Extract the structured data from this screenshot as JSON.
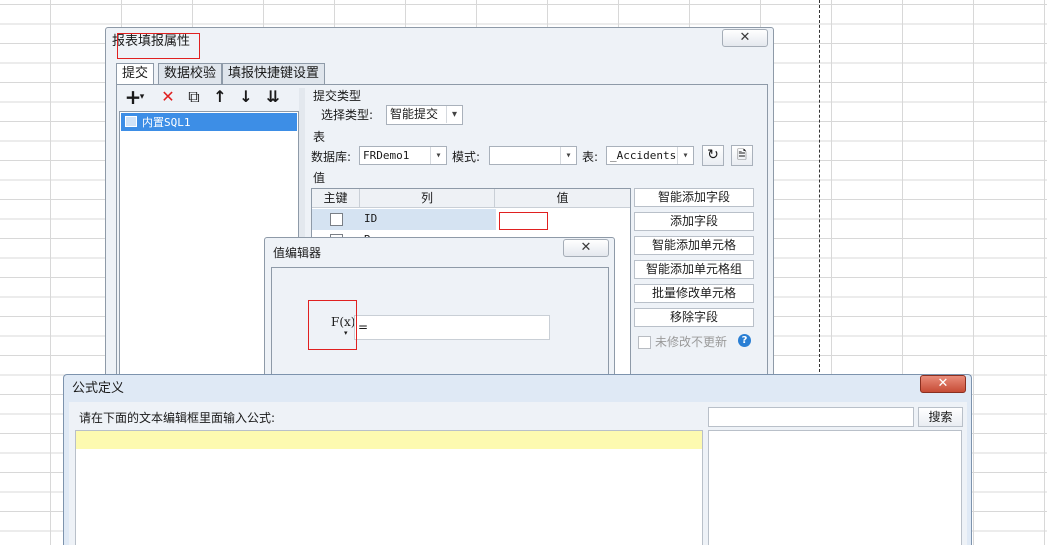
{
  "report_dialog": {
    "title": "报表填报属性",
    "close_label": "✕",
    "tabs": [
      {
        "label": "提交",
        "active": true
      },
      {
        "label": "数据校验",
        "active": false
      },
      {
        "label": "填报快捷键设置",
        "active": false
      }
    ],
    "toolbar": {
      "add": "+",
      "add_menu": "▾",
      "delete": "✕",
      "copy": "⧉",
      "up": "↑",
      "down": "↓",
      "move": "⇊"
    },
    "list_items": [
      {
        "label": "内置SQL1",
        "selected": true
      }
    ],
    "submit_type": {
      "section": "提交类型",
      "label": "选择类型:",
      "value": "智能提交"
    },
    "table_section": {
      "section": "表",
      "db_label": "数据库:",
      "db_value": "FRDemo1",
      "schema_label": "模式:",
      "schema_value": "",
      "table_label": "表:",
      "table_value": "_Accidents"
    },
    "value_section": {
      "section": "值",
      "columns": [
        "主键",
        "列",
        "值"
      ],
      "rows": [
        {
          "column": "ID",
          "value": ""
        },
        {
          "column": "R",
          "value": ""
        }
      ]
    },
    "side_buttons": [
      "智能添加字段",
      "添加字段",
      "智能添加单元格",
      "智能添加单元格组",
      "批量修改单元格",
      "移除字段"
    ],
    "unmodified_label": "未修改不更新",
    "help": "?"
  },
  "value_editor": {
    "title": "值编辑器",
    "close_label": "✕",
    "fx_label": "F(x)",
    "value": "="
  },
  "formula_dialog": {
    "title": "公式定义",
    "close_label": "✕",
    "prompt": "请在下面的文本编辑框里面输入公式:",
    "search_placeholder": "",
    "search_button": "搜索"
  }
}
